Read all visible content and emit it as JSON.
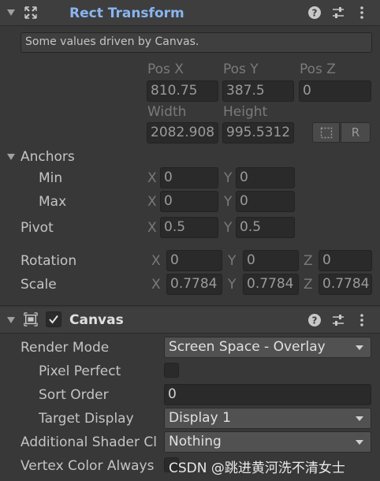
{
  "rect_transform": {
    "title": "Rect Transform",
    "driven_message": "Some values driven by Canvas.",
    "pos_x_label": "Pos X",
    "pos_y_label": "Pos Y",
    "pos_z_label": "Pos Z",
    "pos_x": "810.75",
    "pos_y": "387.5",
    "pos_z": "0",
    "width_label": "Width",
    "height_label": "Height",
    "width": "2082.908",
    "height": "995.5312",
    "raw_edit_button": "R",
    "anchors_label": "Anchors",
    "min_label": "Min",
    "max_label": "Max",
    "x_axis": "X",
    "y_axis": "Y",
    "z_axis": "Z",
    "anchor_min_x": "0",
    "anchor_min_y": "0",
    "anchor_max_x": "0",
    "anchor_max_y": "0",
    "pivot_label": "Pivot",
    "pivot_x": "0.5",
    "pivot_y": "0.5",
    "rotation_label": "Rotation",
    "rotation_x": "0",
    "rotation_y": "0",
    "rotation_z": "0",
    "scale_label": "Scale",
    "scale_x": "0.7784",
    "scale_y": "0.7784",
    "scale_z": "0.7784"
  },
  "canvas": {
    "title": "Canvas",
    "render_mode_label": "Render Mode",
    "render_mode_value": "Screen Space - Overlay",
    "pixel_perfect_label": "Pixel Perfect",
    "sort_order_label": "Sort Order",
    "sort_order_value": "0",
    "target_display_label": "Target Display",
    "target_display_value": "Display 1",
    "additional_shader_label": "Additional Shader Cl",
    "additional_shader_value": "Nothing",
    "vertex_color_label": "Vertex Color Always"
  },
  "watermark": "CSDN @跳进黄河洗不清女士",
  "colors": {
    "title_blue": "#8ab4f0",
    "panel_bg": "#383838",
    "header_bg": "#3e3e3e",
    "field_bg": "#2a2a2a",
    "dropdown_bg": "#515151"
  }
}
